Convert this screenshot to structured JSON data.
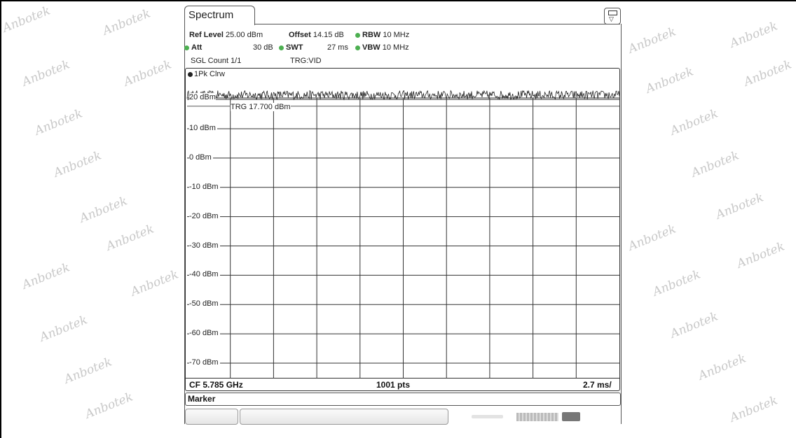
{
  "watermark_text": "Anbotek",
  "tab": {
    "label": "Spectrum"
  },
  "header": {
    "ref_level_label": "Ref Level",
    "ref_level_value": "25.00 dBm",
    "offset_label": "Offset",
    "offset_value": "14.15 dB",
    "rbw_label": "RBW",
    "rbw_value": "10 MHz",
    "att_label": "Att",
    "att_value": "30 dB",
    "swt_label": "SWT",
    "swt_value": "27 ms",
    "vbw_label": "VBW",
    "vbw_value": "10 MHz",
    "sgl_count": "SGL Count 1/1",
    "trg": "TRG:VID"
  },
  "trace": {
    "label": "1Pk Clrw",
    "trigger_label": "TRG  17.700 dBm"
  },
  "chart_data": {
    "type": "line",
    "ylabels": [
      "20 dBm",
      "10 dBm",
      "0 dBm",
      "-10 dBm",
      "-20 dBm",
      "-30 dBm",
      "-40 dBm",
      "-50 dBm",
      "-60 dBm",
      "-70 dBm"
    ],
    "yticks": [
      20,
      10,
      0,
      -10,
      -20,
      -30,
      -40,
      -50,
      -60,
      -70
    ],
    "ylim": [
      -80,
      25
    ],
    "x_divisions": 10,
    "trigger_level_dbm": 17.7,
    "trace_level_dbm": 21.5,
    "trace_ripple_db": 1.5,
    "points": 1001,
    "center_frequency": "CF 5.785 GHz",
    "points_label": "1001 pts",
    "span_label": "2.7 ms/"
  },
  "marker_label": "Marker",
  "colors": {
    "status_dot": "#4caf50",
    "trace": "#222222",
    "grid": "#333333"
  }
}
